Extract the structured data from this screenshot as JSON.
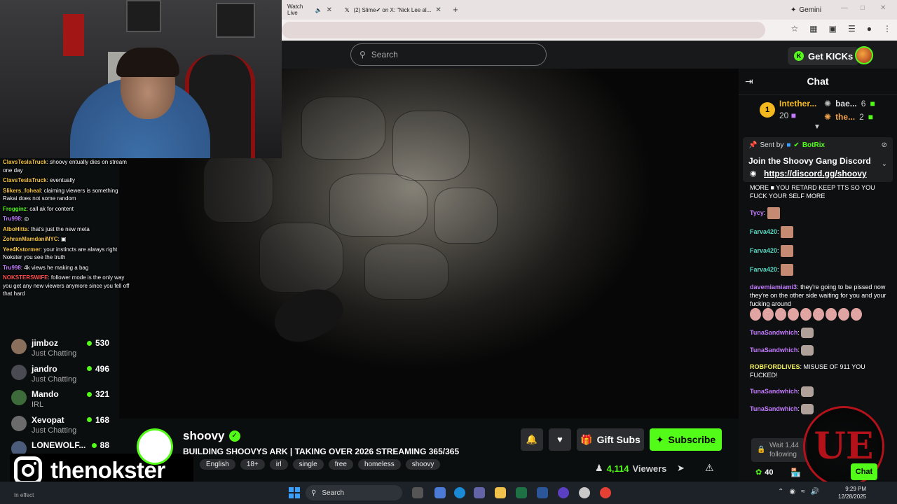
{
  "browser": {
    "tabs": [
      {
        "label": "Watch Live"
      },
      {
        "label": "(2) Slime✔ on X: \"Nick Lee al..."
      }
    ],
    "new_tab_icon": "plus-icon",
    "gemini_label": "Gemini"
  },
  "header": {
    "search_placeholder": "Search",
    "get_kicks_label": "Get KICKs"
  },
  "overlay_chat": [
    {
      "user": "ClavsTeslaTruck",
      "color": "#f5c542",
      "text": "shoovy entually dies on stream one day"
    },
    {
      "user": "ClavsTeslaTruck",
      "color": "#f5c542",
      "text": "eventually"
    },
    {
      "user": "Slikers_foheal",
      "color": "#f5c542",
      "text": "claiming viewers is something Rakai does not some random"
    },
    {
      "user": "Frogginz",
      "color": "#53fc18",
      "text": "call ak for content"
    },
    {
      "user": "Tru998",
      "color": "#c37cff",
      "text": "◎"
    },
    {
      "user": "AlboHitta",
      "color": "#f5c542",
      "text": "that's just the new meta"
    },
    {
      "user": "ZohranMamdaniNYC",
      "color": "#f5c542",
      "text": "▣"
    },
    {
      "user": "Yee4Kstormer",
      "color": "#f5c542",
      "text": "your instincts are always right Nokster you see the truth"
    },
    {
      "user": "Tru998",
      "color": "#c37cff",
      "text": "4k views he making a bag"
    },
    {
      "user": "NOKSTERSWIFE",
      "color": "#ff5050",
      "text": "follower mode is the only way you get any new viewers anymore since you fell off that hard"
    }
  ],
  "sidebar": [
    {
      "name": "jimboz",
      "category": "Just Chatting",
      "viewers": "530",
      "avatar": "#8a6f5c"
    },
    {
      "name": "jandro",
      "category": "Just Chatting",
      "viewers": "496",
      "avatar": "#4a4a52"
    },
    {
      "name": "Mando",
      "category": "IRL",
      "viewers": "321",
      "avatar": "#3e6b3a"
    },
    {
      "name": "Xevopat",
      "category": "Just Chatting",
      "viewers": "168",
      "avatar": "#6b6b6b"
    },
    {
      "name": "LONEWOLF...",
      "category": "",
      "viewers": "88",
      "avatar": "#4a5c7a"
    }
  ],
  "instagram": {
    "handle": "thenokster"
  },
  "stream": {
    "streamer": "shoovy",
    "title": "BUILDING SHOOVYS ARK | TAKING OVER 2026 STREAMING 365/365",
    "tags": [
      "English",
      "18+",
      "irl",
      "single",
      "free",
      "homeless",
      "shoovy"
    ],
    "gift_label": "Gift Subs",
    "subscribe_label": "Subscribe",
    "viewer_count": "4,114",
    "viewers_label": "Viewers"
  },
  "chat": {
    "title": "Chat",
    "leaderboard": {
      "first": {
        "rank": "1",
        "name": "Intether...",
        "count": "20"
      },
      "second": {
        "name": "bae...",
        "count": "6"
      },
      "third": {
        "name": "the...",
        "count": "2"
      }
    },
    "pinned": {
      "sent_by_label": "Sent by",
      "bot_name": "BotRix",
      "title": "Join the Shoovy Gang Discord",
      "link": "https://discord.gg/shoovy"
    },
    "messages": [
      {
        "user": "",
        "color": "#fff",
        "text": "MORE ■ YOU RETARD KEEP TTS SO YOU FUCK YOUR SELF MORE"
      },
      {
        "user": "Tycy",
        "color": "#c37cff",
        "text": ""
      },
      {
        "user": "Farva420",
        "color": "#5ad9c4",
        "text": ""
      },
      {
        "user": "Farva420",
        "color": "#5ad9c4",
        "text": ""
      },
      {
        "user": "Farva420",
        "color": "#5ad9c4",
        "text": ""
      },
      {
        "user": "davemiamiami3",
        "color": "#c37cff",
        "text": "they're going to be pissed now they're on the other side waiting for you and your fucking around"
      },
      {
        "user": "TunaSandwhich",
        "color": "#c37cff",
        "text": ""
      },
      {
        "user": "TunaSandwhich",
        "color": "#c37cff",
        "text": ""
      },
      {
        "user": "ROBFORDLIVES",
        "color": "#f5f060",
        "text": "MISUSE OF 911 YOU FUCKED!"
      },
      {
        "user": "TunaSandwhich",
        "color": "#c37cff",
        "text": ""
      },
      {
        "user": "TunaSandwhich",
        "color": "#c37cff",
        "text": ""
      }
    ],
    "wait_text": "Wait 1,44",
    "following_text": "following",
    "kicks_count": "40",
    "chat_button": "Chat",
    "logo_text": "UE"
  },
  "taskbar": {
    "search_label": "Search",
    "in_effect": "In effect",
    "time": "9:29 PM",
    "date": "12/28/2025"
  }
}
